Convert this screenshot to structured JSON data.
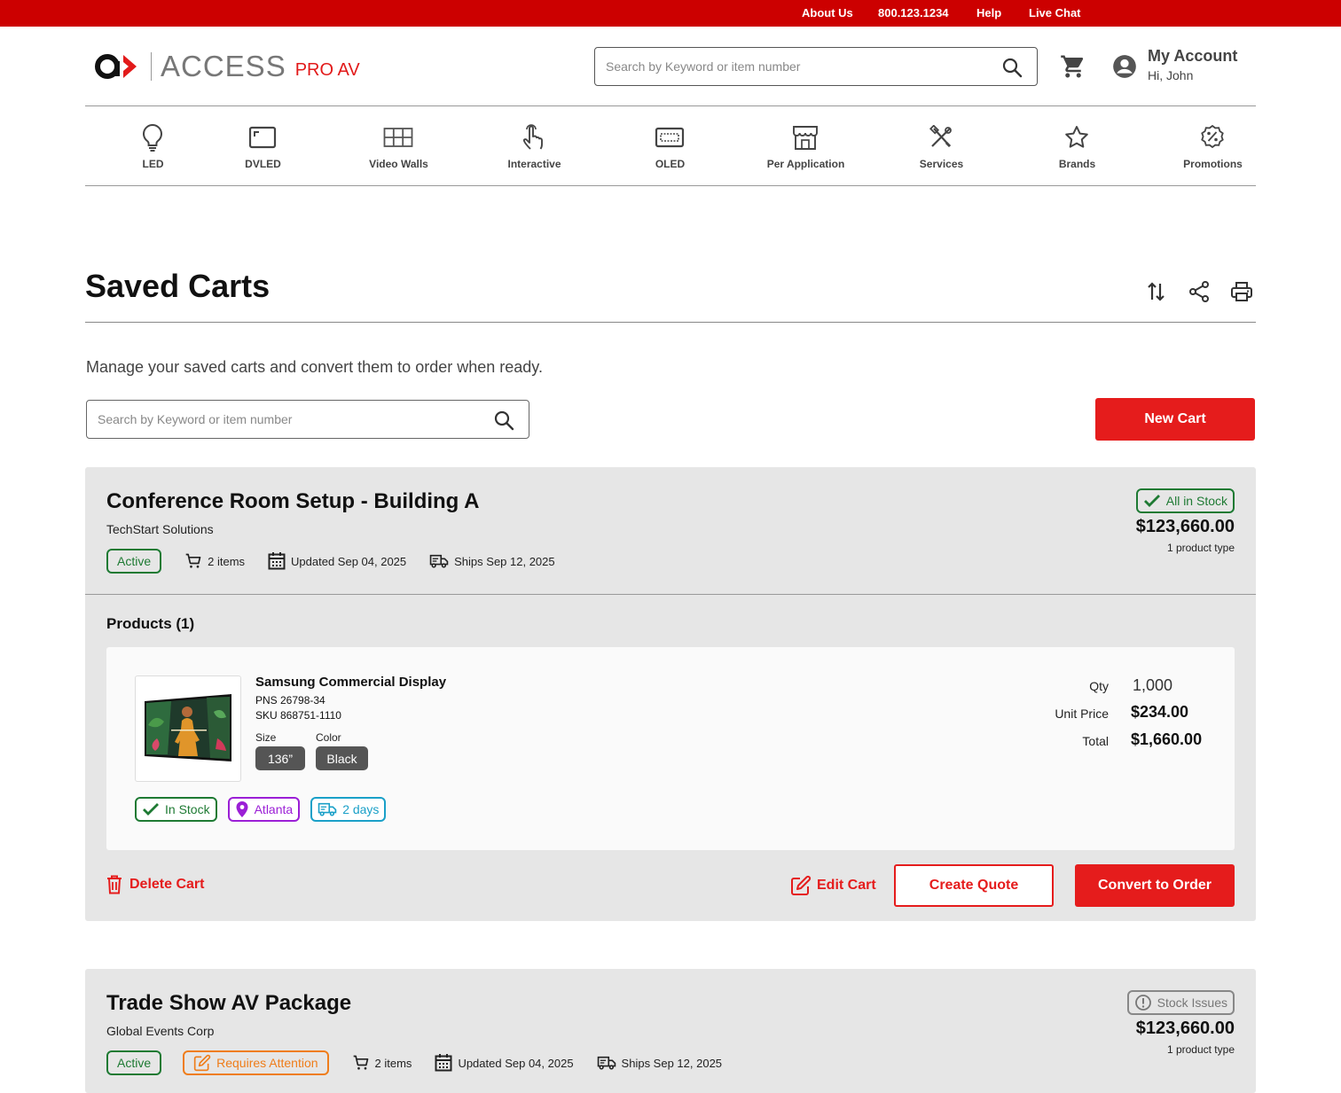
{
  "topbar": {
    "links": [
      "About Us",
      "800.123.1234",
      "Help",
      "Live Chat"
    ]
  },
  "header": {
    "logo_text": "ACCESS",
    "logo_sub": "PRO AV",
    "search_placeholder": "Search by Keyword or item number",
    "account_title": "My Account",
    "account_greeting": "Hi, John"
  },
  "nav": {
    "items": [
      {
        "label": "LED",
        "icon": "lightbulb-icon"
      },
      {
        "label": "DVLED",
        "icon": "dvled-display-icon"
      },
      {
        "label": "Video Walls",
        "icon": "grid-icon"
      },
      {
        "label": "Interactive",
        "icon": "touch-hand-icon"
      },
      {
        "label": "OLED",
        "icon": "oled-display-icon"
      },
      {
        "label": "Per Application",
        "icon": "storefront-icon"
      },
      {
        "label": "Services",
        "icon": "tools-icon"
      },
      {
        "label": "Brands",
        "icon": "star-icon"
      },
      {
        "label": "Promotions",
        "icon": "percent-badge-icon"
      }
    ]
  },
  "page": {
    "title": "Saved Carts",
    "intro": "Manage your saved carts and convert them to order when ready.",
    "search_placeholder": "Search by Keyword or item number",
    "new_cart_label": "New Cart"
  },
  "carts": [
    {
      "name": "Conference Room Setup - Building A",
      "company": "TechStart Solutions",
      "status": "Active",
      "items": "2 items",
      "updated": "Updated Sep 04, 2025",
      "ships": "Ships Sep 12, 2025",
      "stock_status": "All in Stock",
      "total": "$123,660.00",
      "product_types": "1 product type",
      "products_heading": "Products (1)",
      "products": [
        {
          "name": "Samsung Commercial Display",
          "pns": "PNS 26798-34",
          "sku": "SKU 868751-1110",
          "size_label": "Size",
          "size": "136”",
          "color_label": "Color",
          "color": "Black",
          "stock": "In Stock",
          "location": "Atlanta",
          "shipping": "2 days",
          "qty_label": "Qty",
          "qty": "1,000",
          "unit_price_label": "Unit Price",
          "unit_price": "$234.00",
          "total_label": "Total",
          "total": "$1,660.00"
        }
      ],
      "actions": {
        "delete": "Delete Cart",
        "edit": "Edit Cart",
        "quote": "Create Quote",
        "convert": "Convert to Order"
      }
    },
    {
      "name": "Trade Show AV Package",
      "company": "Global Events Corp",
      "status": "Active",
      "attention": "Requires Attention",
      "items": "2 items",
      "updated": "Updated Sep 04, 2025",
      "ships": "Ships Sep 12, 2025",
      "stock_status": "Stock Issues",
      "total": "$123,660.00",
      "product_types": "1 product type"
    }
  ],
  "colors": {
    "brand_red": "#cc0000",
    "button_red": "#e51c1c",
    "success_green": "#1e7a33",
    "warning_orange": "#ef7d1a",
    "location_purple": "#9b1fd6",
    "shipping_teal": "#1aa0c8"
  }
}
